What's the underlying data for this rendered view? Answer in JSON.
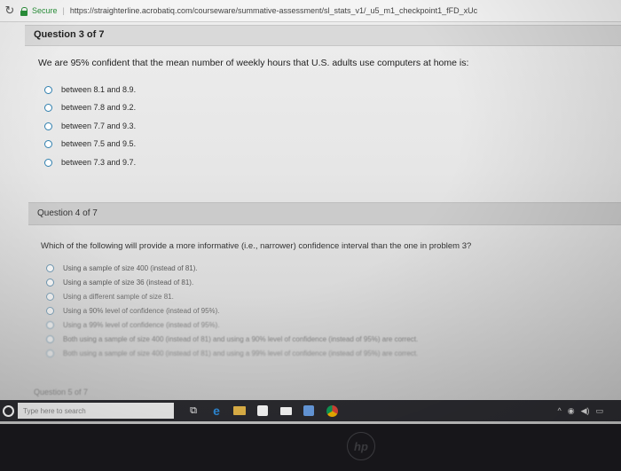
{
  "browser": {
    "reload_icon": "reload-icon",
    "secure_label": "Secure",
    "url": "https://straighterline.acrobatiq.com/courseware/summative-assessment/sl_stats_v1/_u5_m1_checkpoint1_fFD_xUc"
  },
  "question3": {
    "header": "Question 3 of 7",
    "text": "We are 95% confident that the mean number of weekly hours that U.S. adults use computers at home is:",
    "options": [
      "between 8.1 and 8.9.",
      "between 7.8 and 9.2.",
      "between 7.7 and 9.3.",
      "between 7.5 and 9.5.",
      "between 7.3 and 9.7."
    ]
  },
  "question4": {
    "header": "Question 4 of 7",
    "text": "Which of the following will provide a more informative (i.e., narrower) confidence interval than the one in problem 3?",
    "options": [
      "Using a sample of size 400 (instead of 81).",
      "Using a sample of size 36 (instead of 81).",
      "Using a different sample of size 81.",
      "Using a 90% level of confidence (instead of 95%).",
      "Using a 99% level of confidence (instead of 95%).",
      "Both using a sample of size 400 (instead of 81) and using a 90% level of confidence (instead of 95%) are correct.",
      "Both using a sample of size 400 (instead of 81) and using a 99% level of confidence (instead of 95%) are correct."
    ]
  },
  "question5": {
    "header": "Question 5 of 7"
  },
  "taskbar": {
    "search_placeholder": "Type here to search",
    "icons": [
      "start-icon",
      "task-view-icon",
      "edge-icon",
      "file-explorer-icon",
      "store-icon",
      "mail-icon",
      "photos-icon",
      "chrome-icon"
    ]
  },
  "colors": {
    "radio": "#2f7fae",
    "taskbar": "#2b2b30",
    "secure": "#2a8f3a"
  }
}
